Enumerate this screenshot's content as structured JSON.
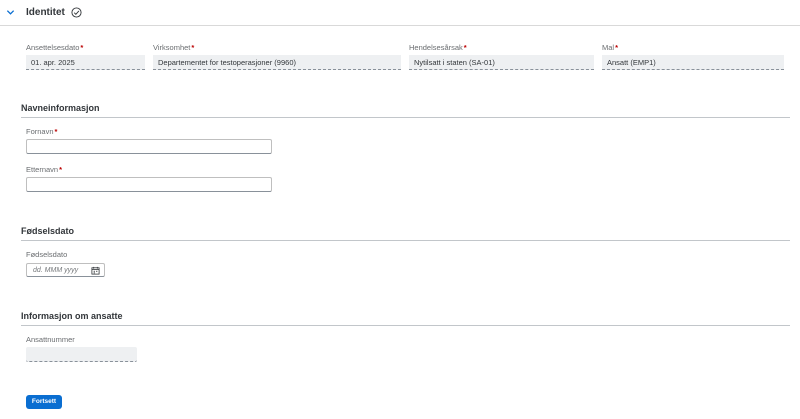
{
  "section": {
    "title": "Identitet",
    "icons": {
      "collapse": "chevron-down-icon",
      "status": "check-circle-icon"
    }
  },
  "identity_fields": [
    {
      "label": "Ansettelsesdato",
      "required": "*",
      "value": "01. apr. 2025"
    },
    {
      "label": "Virksomhet",
      "required": "*",
      "value": "Departementet for testoperasjoner (9960)"
    },
    {
      "label": "Hendelsesårsak",
      "required": "*",
      "value": "Nytilsatt i staten (SA-01)"
    },
    {
      "label": "Mal",
      "required": "*",
      "value": "Ansatt (EMP1)"
    }
  ],
  "name_info": {
    "title": "Navneinformasjon",
    "first_name": {
      "label": "Fornavn",
      "required": "*",
      "value": ""
    },
    "last_name": {
      "label": "Etternavn",
      "required": "*",
      "value": ""
    }
  },
  "birth": {
    "title": "Fødselsdato",
    "label": "Fødselsdato",
    "placeholder": "dd. MMM yyyy",
    "icon": "calendar-icon"
  },
  "employee_info": {
    "title": "Informasjon om ansatte",
    "number_label": "Ansattnummer",
    "number_value": ""
  },
  "actions": {
    "continue_label": "Fortsett"
  },
  "colors": {
    "accent": "#0a6ed1",
    "required": "#bb0000",
    "readonly_bg": "#eef0f2"
  }
}
